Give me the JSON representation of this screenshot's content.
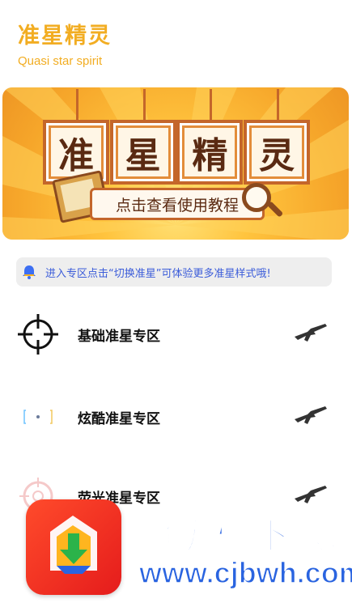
{
  "header": {
    "title": "准星精灵",
    "subtitle": "Quasi star spirit"
  },
  "banner": {
    "tiles": [
      "准",
      "星",
      "精",
      "灵"
    ],
    "guide_label": "点击查看使用教程"
  },
  "notice": {
    "text": "进入专区点击“切换准星”可体验更多准星样式哦!"
  },
  "zones": [
    {
      "label": "基础准星专区",
      "icon": "crosshair-basic-icon"
    },
    {
      "label": "炫酷准星专区",
      "icon": "crosshair-cool-icon"
    },
    {
      "label": "荧光准星专区",
      "icon": "crosshair-neon-icon"
    }
  ],
  "watermark": {
    "title": "超级棒下载站",
    "url": "www.cjbwh.com"
  },
  "colors": {
    "accent": "#f2ad22",
    "notice_text": "#3b5cd9",
    "watermark_blue": "#2a64e0"
  }
}
